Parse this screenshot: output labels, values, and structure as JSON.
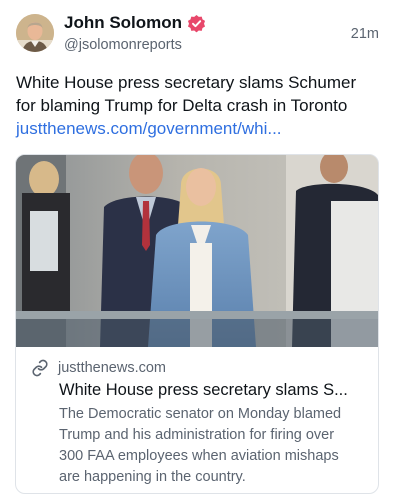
{
  "author": {
    "display_name": "John Solomon",
    "handle": "@jsolomonreports",
    "verified_icon": "verified-badge-icon",
    "avatar_icon": "avatar"
  },
  "post": {
    "timestamp": "21m",
    "text_lines": [
      "White House press secretary slams Schumer",
      "for blaming Trump for Delta crash in Toronto"
    ],
    "link_text": "justthenews.com/government/whi..."
  },
  "card": {
    "domain": "justthenews.com",
    "link_icon": "link-icon",
    "title": "White House press secretary slams S...",
    "description_lines": [
      "The Democratic senator on Monday blamed",
      "Trump and his administration for firing over",
      "300 FAA employees when aviation mishaps",
      "are happening in the country."
    ]
  },
  "colors": {
    "link": "#2f6fe0",
    "verified_badge": "#e8486b",
    "secondary_text": "#5b6470",
    "border": "#dfe3e8"
  }
}
